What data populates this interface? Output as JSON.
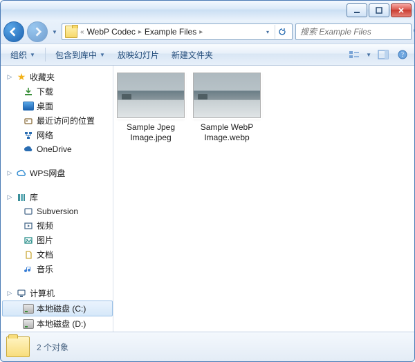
{
  "titlebar": {
    "minimize_hint": "Minimize",
    "maximize_hint": "Maximize",
    "close_hint": "Close"
  },
  "breadcrumb": {
    "overflow": "«",
    "segments": [
      "WebP Codec",
      "Example Files"
    ]
  },
  "search": {
    "placeholder": "搜索 Example Files"
  },
  "toolbar": {
    "organize": "组织",
    "include": "包含到库中",
    "slideshow": "放映幻灯片",
    "newfolder": "新建文件夹"
  },
  "nav": {
    "favorites": {
      "label": "收藏夹",
      "items": [
        {
          "id": "downloads",
          "label": "下载"
        },
        {
          "id": "desktop",
          "label": "桌面"
        },
        {
          "id": "recent",
          "label": "最近访问的位置"
        },
        {
          "id": "network",
          "label": "网络"
        },
        {
          "id": "onedrive",
          "label": "OneDrive"
        }
      ]
    },
    "wps": {
      "label": "WPS网盘"
    },
    "libraries": {
      "label": "库",
      "items": [
        {
          "id": "subversion",
          "label": "Subversion"
        },
        {
          "id": "videos",
          "label": "视频"
        },
        {
          "id": "pictures",
          "label": "图片"
        },
        {
          "id": "documents",
          "label": "文档"
        },
        {
          "id": "music",
          "label": "音乐"
        }
      ]
    },
    "computer": {
      "label": "计算机",
      "items": [
        {
          "id": "drive-c",
          "label": "本地磁盘 (C:)",
          "selected": true
        },
        {
          "id": "drive-d",
          "label": "本地磁盘 (D:)"
        }
      ]
    }
  },
  "files": [
    {
      "id": "sample-jpeg",
      "name": "Sample Jpeg Image.jpeg"
    },
    {
      "id": "sample-webp",
      "name": "Sample WebP Image.webp"
    }
  ],
  "status": {
    "text": "2 个对象"
  }
}
